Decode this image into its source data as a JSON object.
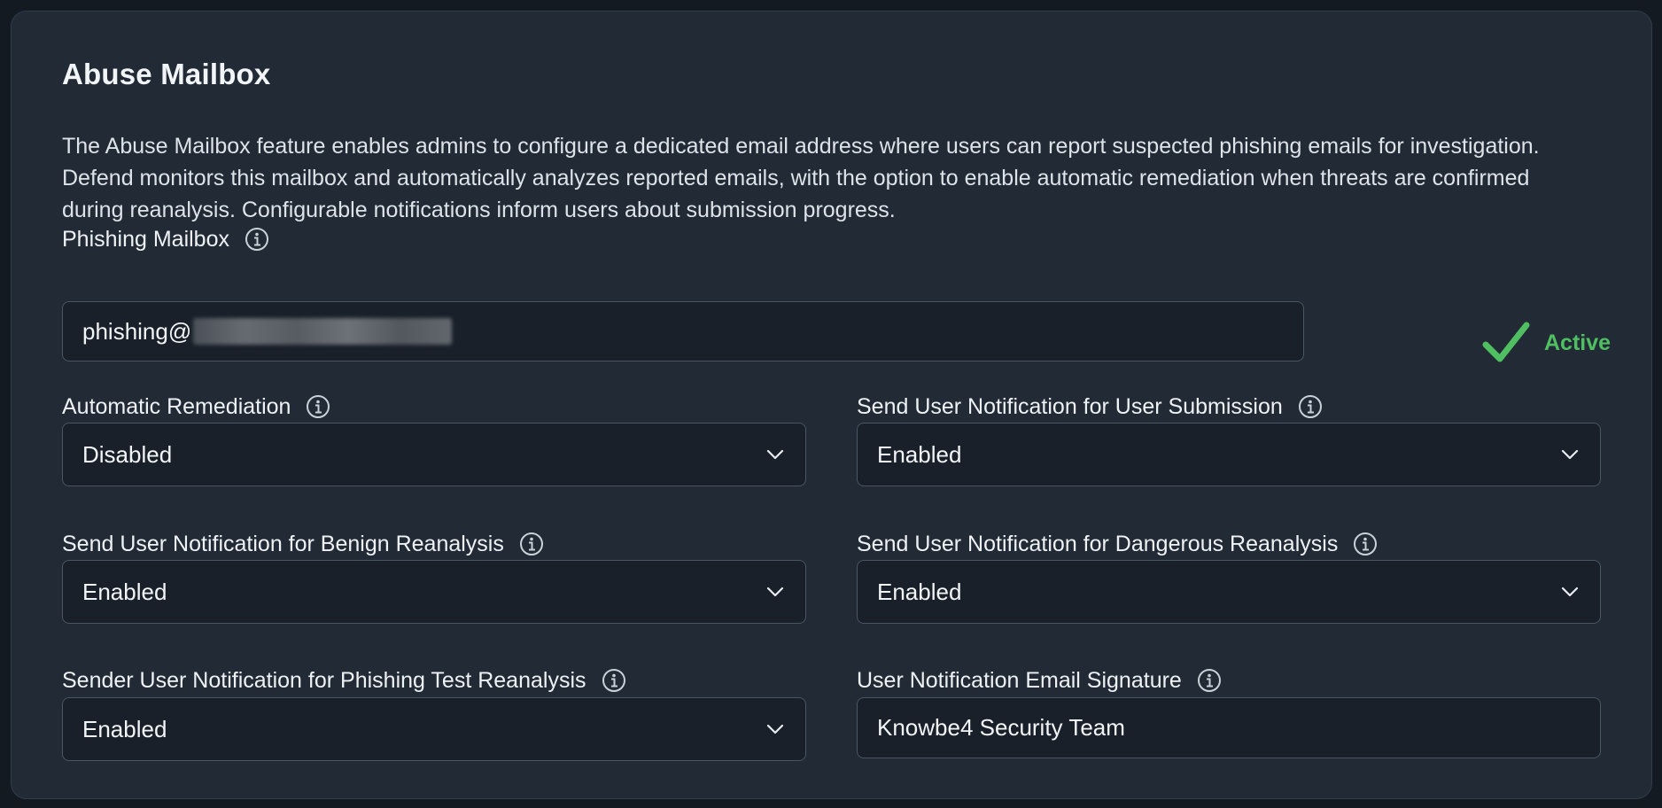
{
  "title": "Abuse Mailbox",
  "description": "The Abuse Mailbox feature enables admins to configure a dedicated email address where users can report suspected phishing emails for investigation. Defend monitors this mailbox and automatically analyzes reported emails, with the option to enable automatic remediation when threats are confirmed during reanalysis. Configurable notifications inform users about submission progress.",
  "phishing_mailbox": {
    "label": "Phishing Mailbox",
    "value_prefix": "phishing@",
    "status": "Active"
  },
  "automatic_remediation": {
    "label": "Automatic Remediation",
    "value": "Disabled"
  },
  "notify_user_submission": {
    "label": "Send User Notification for User Submission",
    "value": "Enabled"
  },
  "notify_benign": {
    "label": "Send User Notification for Benign Reanalysis",
    "value": "Enabled"
  },
  "notify_dangerous": {
    "label": "Send User Notification for Dangerous Reanalysis",
    "value": "Enabled"
  },
  "notify_phishing_test": {
    "label": "Sender User Notification for Phishing Test Reanalysis",
    "value": "Enabled"
  },
  "email_signature": {
    "label": "User Notification Email Signature",
    "value": "Knowbe4 Security Team"
  },
  "colors": {
    "active": "#4fbf62",
    "card": "#212a35",
    "field": "#1a2029"
  },
  "icons": {
    "info": "info-circle-icon",
    "chevron": "chevron-down-icon",
    "check": "checkmark-icon"
  }
}
